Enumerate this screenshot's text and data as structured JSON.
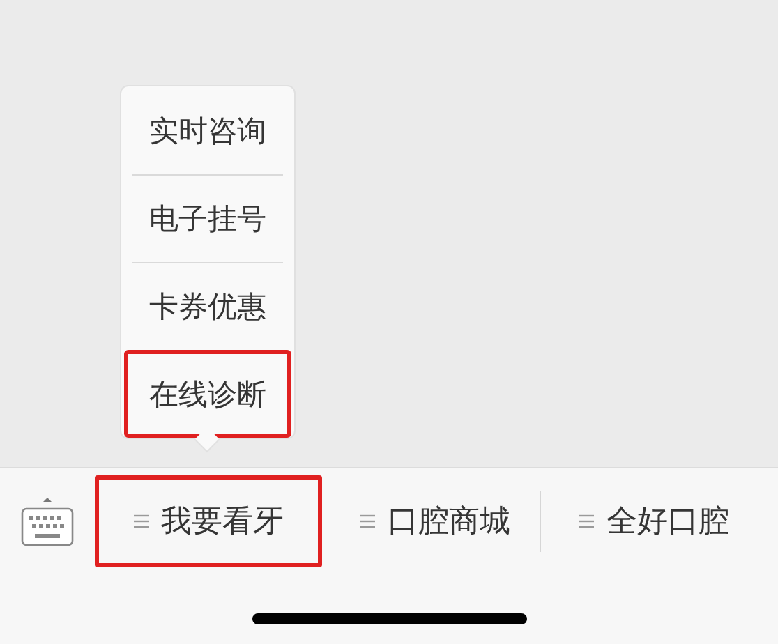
{
  "menu": [
    {
      "label": "我要看牙",
      "expanded": true,
      "highlighted": true,
      "submenu": [
        {
          "label": "实时咨询",
          "highlighted": false
        },
        {
          "label": "电子挂号",
          "highlighted": false
        },
        {
          "label": "卡券优惠",
          "highlighted": false
        },
        {
          "label": "在线诊断",
          "highlighted": true
        }
      ]
    },
    {
      "label": "口腔商城",
      "highlighted": false,
      "separator_before": false
    },
    {
      "label": "全好口腔",
      "highlighted": false,
      "separator_before": true
    }
  ]
}
